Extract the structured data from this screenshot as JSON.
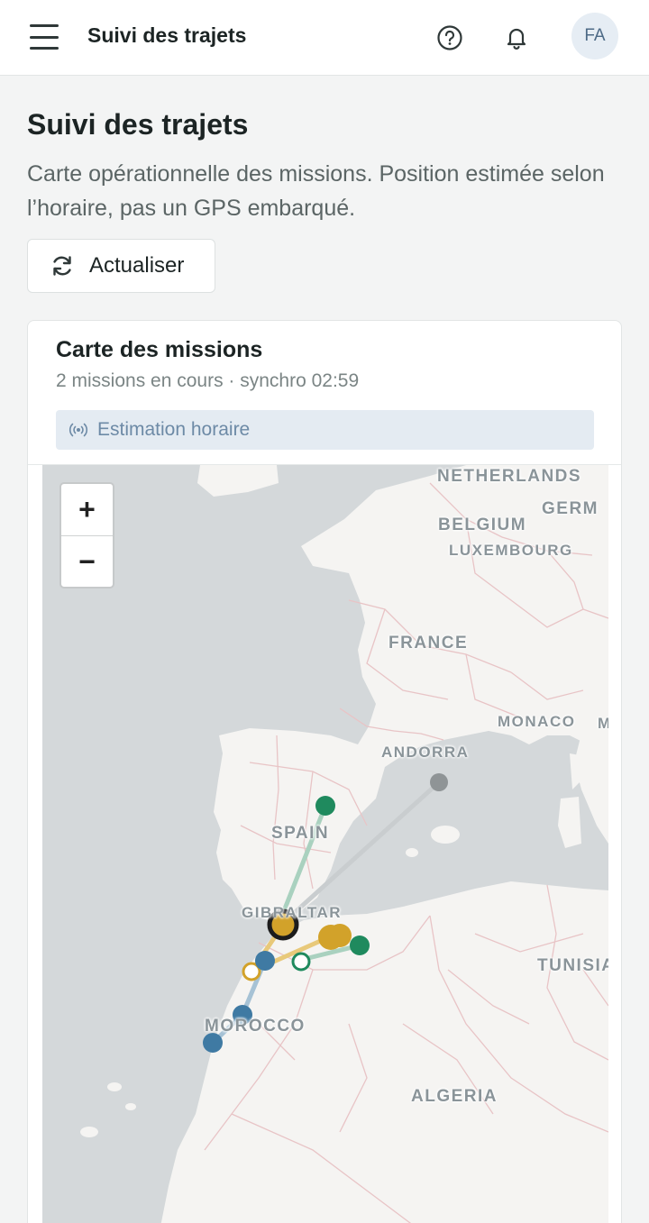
{
  "topbar": {
    "title": "Suivi des trajets",
    "menu_icon": "hamburger-menu-icon",
    "help_icon": "question-circle-icon",
    "notification_icon": "bell-icon",
    "avatar_initials": "FA"
  },
  "header": {
    "title": "Suivi des trajets",
    "subtitle": "Carte opérationnelle des missions. Position estimée selon l’horaire, pas un GPS embarqué.",
    "refresh_label": "Actualiser",
    "refresh_icon": "refresh-icon"
  },
  "card": {
    "title": "Carte des missions",
    "meta": "2 missions en cours · synchro 02:59",
    "badge_label": "Estimation horaire",
    "badge_icon": "broadcast-signal-icon"
  },
  "map": {
    "zoom_in": "+",
    "zoom_out": "−",
    "labels": {
      "netherlands": "NETHERLANDS",
      "germany": "GERM",
      "belgium": "BELGIUM",
      "luxembourg": "LUXEMBOURG",
      "france": "FRANCE",
      "monaco": "MONACO",
      "monaco_extra": "M",
      "andorra": "ANDORRA",
      "spain": "SPAIN",
      "gibraltar": "GIBRALTAR",
      "tunisia": "TUNISIA",
      "morocco": "MOROCCO",
      "algeria": "ALGERIA"
    },
    "colors": {
      "green": "#1f8a5e",
      "gold": "#d2a22a",
      "blue": "#3f7aa3",
      "gray": "#8f9496",
      "sea": "#d4d8da",
      "land": "#f5f4f2"
    }
  }
}
